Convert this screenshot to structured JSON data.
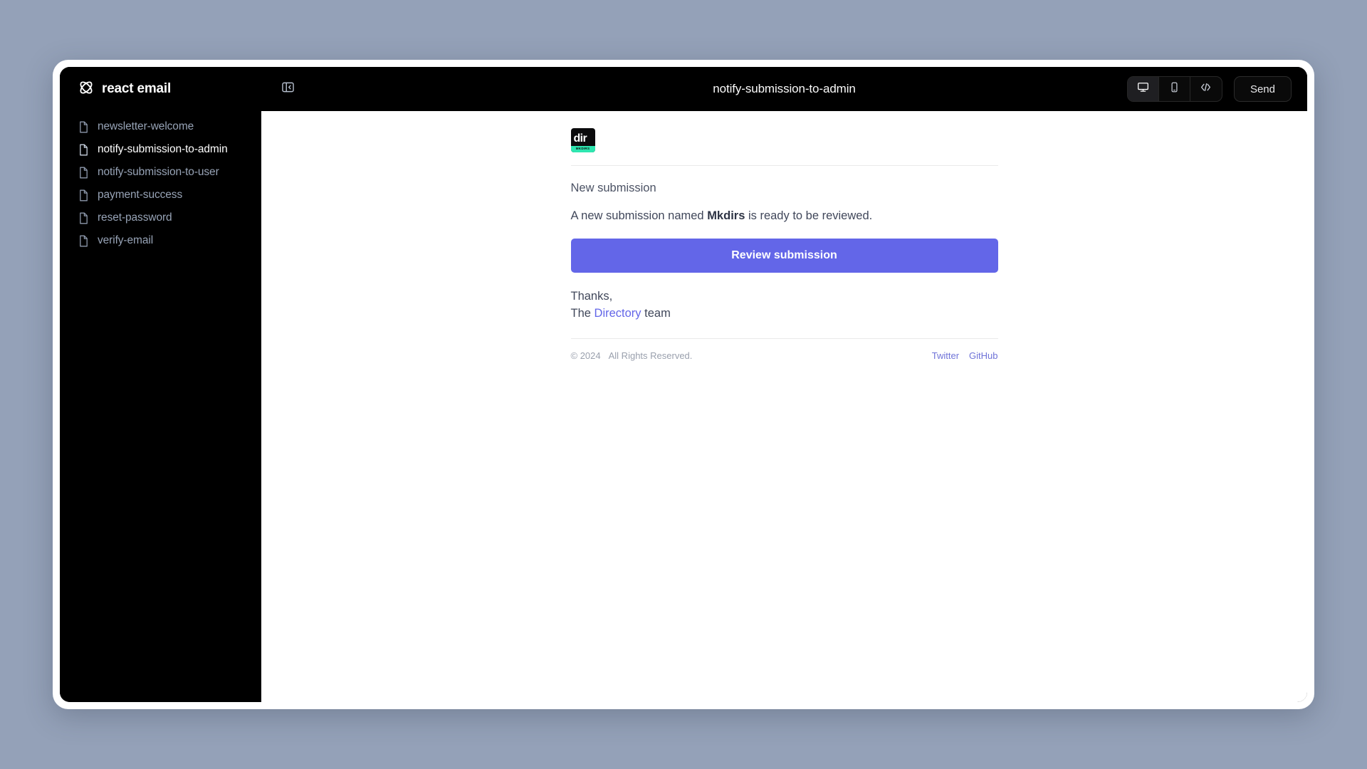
{
  "brand": {
    "name": "react email",
    "logo_icon": "atom-icon"
  },
  "sidebar": {
    "items": [
      {
        "label": "newsletter-welcome",
        "icon": "file-icon",
        "active": false
      },
      {
        "label": "notify-submission-to-admin",
        "icon": "file-icon",
        "active": true
      },
      {
        "label": "notify-submission-to-user",
        "icon": "file-icon",
        "active": false
      },
      {
        "label": "payment-success",
        "icon": "file-icon",
        "active": false
      },
      {
        "label": "reset-password",
        "icon": "file-icon",
        "active": false
      },
      {
        "label": "verify-email",
        "icon": "file-icon",
        "active": false
      }
    ]
  },
  "topbar": {
    "collapse_icon": "sidebar-collapse-icon",
    "title": "notify-submission-to-admin",
    "view_modes": [
      {
        "name": "desktop",
        "icon": "monitor-icon",
        "active": true
      },
      {
        "name": "mobile",
        "icon": "mobile-icon",
        "active": false
      },
      {
        "name": "source",
        "icon": "code-icon",
        "active": false
      }
    ],
    "send_label": "Send"
  },
  "email": {
    "logo": {
      "text": "dir",
      "band_text": "MKDIRS",
      "background": "#0b0b0d",
      "band_color": "#2ee6b0"
    },
    "heading": "New submission",
    "body_prefix": "A new submission named ",
    "body_bold": "Mkdirs",
    "body_suffix": " is ready to be reviewed.",
    "cta_label": "Review submission",
    "signoff_line1": "Thanks,",
    "signoff_the": "The ",
    "signoff_link": "Directory",
    "signoff_team": " team",
    "footer": {
      "copyright": "© 2024",
      "rights": "All Rights Reserved.",
      "links": [
        {
          "label": "Twitter"
        },
        {
          "label": "GitHub"
        }
      ]
    }
  },
  "colors": {
    "accent": "#6366e8",
    "brand_green": "#2ee6b0",
    "page_background": "#94a1b8",
    "chrome": "#000000"
  }
}
